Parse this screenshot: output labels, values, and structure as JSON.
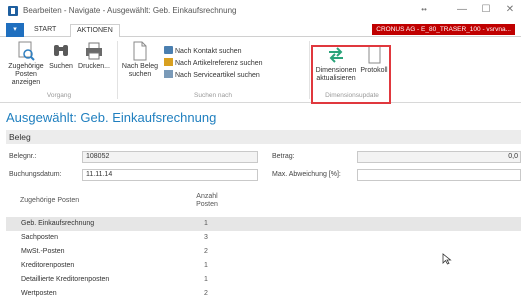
{
  "window": {
    "title": "Bearbeiten - Navigate - Ausgewählt: Geb. Einkaufsrechnung",
    "controls": {
      "dots": "••",
      "minimize": "—",
      "maximize": "☐",
      "close": "✕"
    }
  },
  "ribbon_tabs": {
    "file": "▾",
    "tabs": [
      "START",
      "AKTIONEN"
    ],
    "company": "CRONUS AG - E_80_TRASER_100 - vsrvna..."
  },
  "ribbon": {
    "vorgang": {
      "label": "Vorgang",
      "buttons": [
        {
          "line1": "Zugehörige",
          "line2": "Posten anzeigen"
        },
        {
          "line1": "Suchen",
          "line2": ""
        },
        {
          "line1": "Drucken...",
          "line2": ""
        }
      ]
    },
    "suchen_nach": {
      "label": "Suchen nach",
      "beleg": {
        "line1": "Nach Beleg",
        "line2": "suchen"
      },
      "small": [
        "Nach Kontakt suchen",
        "Nach Artikelreferenz suchen",
        "Nach Serviceartikel suchen"
      ]
    },
    "dimensionsupdate": {
      "label": "Dimensionsupdate",
      "buttons": [
        {
          "line1": "Dimensionen",
          "line2": "aktualisieren"
        },
        {
          "line1": "Protokoll",
          "line2": ""
        }
      ]
    }
  },
  "page": {
    "title": "Ausgewählt: Geb. Einkaufsrechnung",
    "section": "Beleg"
  },
  "fields": {
    "belegnr": {
      "label": "Belegnr.:",
      "value": "108052"
    },
    "buchungsdatum": {
      "label": "Buchungsdatum:",
      "value": "11.11.14"
    },
    "betrag": {
      "label": "Betrag:",
      "value": "0,0"
    },
    "max_abweichung": {
      "label": "Max. Abweichung [%]:",
      "value": ""
    }
  },
  "table": {
    "headers": {
      "posten": "Zugehörige Posten",
      "anzahl_line1": "Anzahl",
      "anzahl_line2": "Posten"
    },
    "rows": [
      {
        "name": "Geb. Einkaufsrechnung",
        "count": "1"
      },
      {
        "name": "Sachposten",
        "count": "3"
      },
      {
        "name": "MwSt.-Posten",
        "count": "2"
      },
      {
        "name": "Kreditorenposten",
        "count": "1"
      },
      {
        "name": "Detaillierte Kreditorenposten",
        "count": "1"
      },
      {
        "name": "Wertposten",
        "count": "2"
      }
    ]
  },
  "colors": {
    "accent": "#1f7fbf",
    "highlight": "#e0383e",
    "company_bg": "#c00000",
    "dimension_icon": "#2aa37a"
  }
}
